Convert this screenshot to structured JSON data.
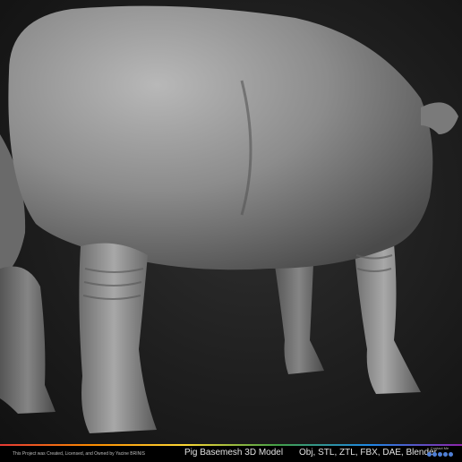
{
  "image": {
    "subject": "grey sculpted pig basemesh render, rear three-quarter view",
    "background_color": "#1e1e1e",
    "model_color": "#8a8a8a"
  },
  "footer": {
    "credit": "This Project was Created, Licensed, and Owned by Yacine BRINIS",
    "title": "Pig Basemesh 3D Model",
    "formats": "Obj, STL, ZTL, FBX, DAE, Blender",
    "contact_label": "Contact Me",
    "social_icons": [
      "social-icon",
      "social-icon",
      "social-icon",
      "social-icon",
      "social-icon"
    ]
  }
}
